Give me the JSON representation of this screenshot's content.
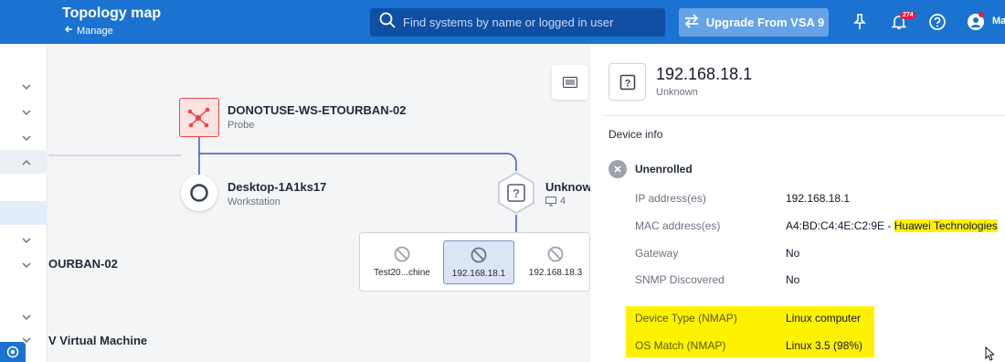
{
  "header": {
    "title": "Topology map",
    "back_label": "Manage",
    "search_placeholder": "Find systems by name or logged in user",
    "upgrade_label": "Upgrade From VSA 9",
    "notification_count": "274",
    "user_initials": "Ma"
  },
  "map": {
    "partial_labels": {
      "left_node": "OURBAN-02",
      "left_vm": "V Virtual Machine"
    },
    "probe": {
      "name": "DONOTUSE-WS-ETOURBAN-02",
      "type": "Probe"
    },
    "workstation": {
      "name": "Desktop-1A1ks17",
      "type": "Workstation"
    },
    "unknown": {
      "name": "Unknow",
      "count": "4"
    },
    "group_items": [
      {
        "label": "Test20...chine",
        "selected": false
      },
      {
        "label": "192.168.18.1",
        "selected": true
      },
      {
        "label": "192.168.18.3",
        "selected": false
      }
    ]
  },
  "panel": {
    "ip": "192.168.18.1",
    "subtitle": "Unknown",
    "section_title": "Device info",
    "status": "Unenrolled",
    "rows": [
      {
        "label": "IP address(es)",
        "value": "192.168.18.1"
      },
      {
        "label": "MAC address(es)",
        "value": "A4:BD:C4:4E:C2:9E",
        "sep": " - ",
        "vendor": "Huawei Technologies"
      },
      {
        "label": "Gateway",
        "value": "No"
      },
      {
        "label": "SNMP Discovered",
        "value": "No"
      },
      {
        "label": "Device Type (NMAP)",
        "value": "Linux computer"
      },
      {
        "label": "OS Match (NMAP)",
        "value": "Linux 3.5 (98%)"
      }
    ]
  },
  "colors": {
    "header_bg": "#1a73d1",
    "probe_red": "#ef4444",
    "highlight": "#fff200",
    "selected_bg": "#dbe5f5"
  }
}
